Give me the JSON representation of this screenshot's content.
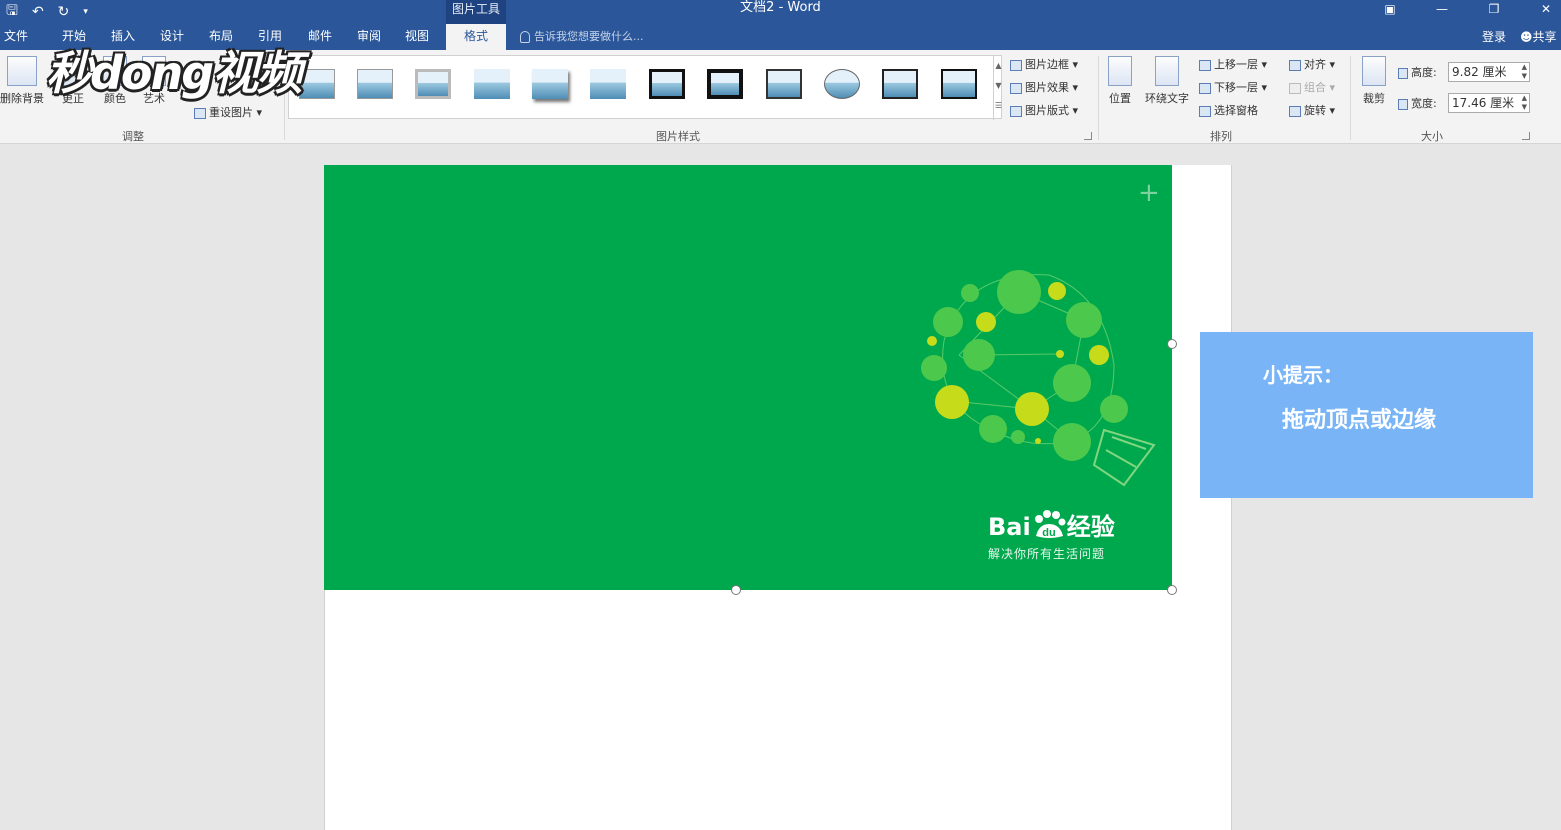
{
  "window": {
    "doc_title": "文档2 - Word",
    "context_tool_label": "图片工具",
    "qat_icons": [
      "save-icon",
      "undo-icon",
      "redo-icon",
      "customize-icon"
    ]
  },
  "tabs": [
    {
      "label": "文件"
    },
    {
      "label": "开始"
    },
    {
      "label": "插入"
    },
    {
      "label": "设计"
    },
    {
      "label": "布局"
    },
    {
      "label": "引用"
    },
    {
      "label": "邮件"
    },
    {
      "label": "审阅"
    },
    {
      "label": "视图"
    },
    {
      "label": "格式"
    }
  ],
  "tell_me": "告诉我您想要做什么...",
  "account": {
    "login": "登录",
    "share": "共享"
  },
  "ribbon": {
    "adjust": {
      "remove_bg": "删除背景",
      "correct": "更正",
      "color": "颜色",
      "art": "艺术",
      "reset": "重设图片",
      "label": "调整"
    },
    "styles": {
      "border": "图片边框",
      "effects": "图片效果",
      "layout": "图片版式",
      "label": "图片样式"
    },
    "arrange": {
      "position": "位置",
      "wrap": "环绕文字",
      "forward": "上移一层",
      "backward": "下移一层",
      "selection_pane": "选择窗格",
      "align": "对齐",
      "group": "组合",
      "rotate": "旋转",
      "label": "排列"
    },
    "size": {
      "crop": "裁剪",
      "height_label": "高度:",
      "height_value": "9.82 厘米",
      "width_label": "宽度:",
      "width_value": "17.46 厘米",
      "label": "大小"
    }
  },
  "watermark": "秒dong视频",
  "picture": {
    "brand": "Bai",
    "brand_tail": "经验",
    "brand_du": "du",
    "slogan": "解决你所有生活问题",
    "bg_color": "#00a84d"
  },
  "tip": {
    "title": "小提示：",
    "body": "拖动顶点或边缘"
  }
}
